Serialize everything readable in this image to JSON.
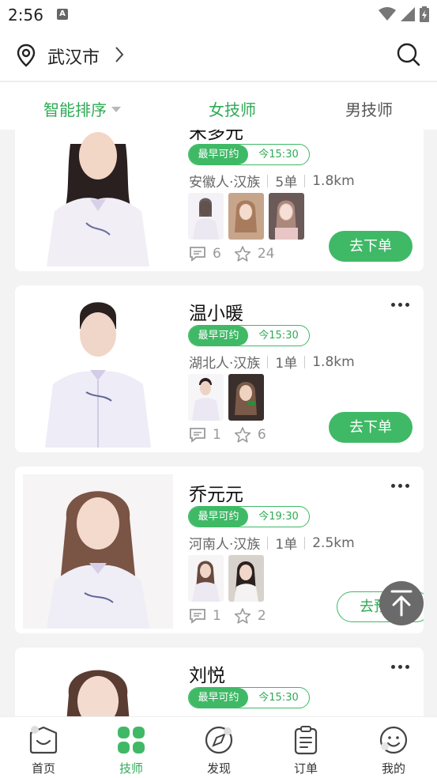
{
  "status": {
    "time": "2:56",
    "notif": "A"
  },
  "header": {
    "city": "武汉市"
  },
  "tabs": [
    {
      "label": "智能排序"
    },
    {
      "label": "女技师"
    },
    {
      "label": "男技师"
    }
  ],
  "cards": [
    {
      "name": "宋多元",
      "avail_label": "最早可约",
      "avail_time": "今15:30",
      "origin": "安徽人·汉族",
      "orders": "5单",
      "distance": "1.8km",
      "comments": "6",
      "favorites": "24",
      "action": "去下单"
    },
    {
      "name": "温小暖",
      "avail_label": "最早可约",
      "avail_time": "今15:30",
      "origin": "湖北人·汉族",
      "orders": "1单",
      "distance": "1.8km",
      "comments": "1",
      "favorites": "6",
      "action": "去下单"
    },
    {
      "name": "乔元元",
      "avail_label": "最早可约",
      "avail_time": "今19:30",
      "origin": "河南人·汉族",
      "orders": "1单",
      "distance": "2.5km",
      "comments": "1",
      "favorites": "2",
      "action": "去预约"
    },
    {
      "name": "刘悦",
      "avail_label": "最早可约",
      "avail_time": "今15:30"
    }
  ],
  "nav": [
    {
      "label": "首页"
    },
    {
      "label": "技师"
    },
    {
      "label": "发现"
    },
    {
      "label": "订单"
    },
    {
      "label": "我的"
    }
  ],
  "colors": {
    "accent": "#3fb966",
    "accent_text": "#2faa55",
    "background": "#f3f3f3"
  }
}
